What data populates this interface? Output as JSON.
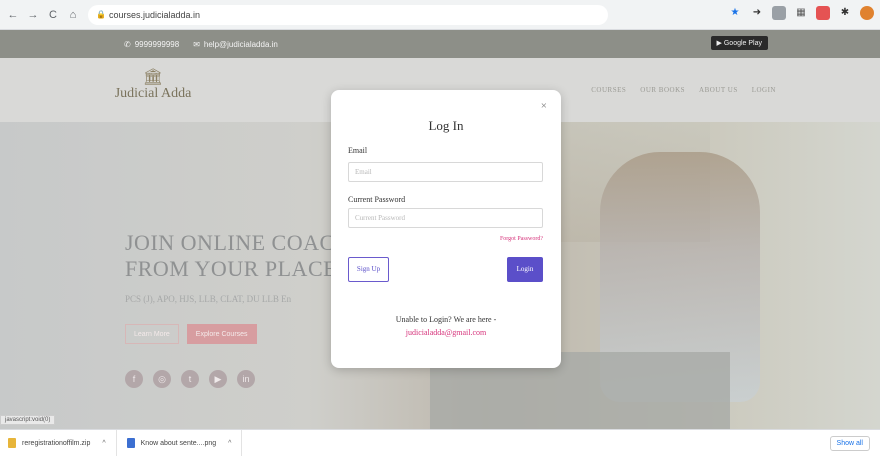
{
  "browser": {
    "url": "courses.judicialadda.in",
    "nav_back": "←",
    "nav_forward": "→",
    "nav_reload": "C",
    "nav_home": "⌂"
  },
  "topbar": {
    "phone": "9999999998",
    "email": "help@judicialadda.in",
    "gplay": "▶ Google Play"
  },
  "header": {
    "logo_mark": "🏛",
    "logo_text": "Judicial Adda",
    "nav": [
      "COURSES",
      "OUR BOOKS",
      "ABOUT US",
      "LOGIN"
    ]
  },
  "hero": {
    "title": "JOIN ONLINE COAC\nFROM YOUR PLACE",
    "subtitle": "PCS (J), APO, HJS, LLB, CLAT, DU LLB En",
    "btn_learn": "Learn More",
    "btn_explore": "Explore Courses",
    "social_icons": [
      "f",
      "◎",
      "t",
      "▶",
      "in"
    ]
  },
  "status_tip": "javascript:void(0)",
  "modal": {
    "close": "×",
    "title": "Log In",
    "email_label": "Email",
    "email_placeholder": "Email",
    "password_label": "Current Password",
    "password_placeholder": "Current Password",
    "forgot": "Forgot Password?",
    "signup": "Sign Up",
    "login": "Login",
    "unable": "Unable to Login? We are here -",
    "support_email": "judicialadda@gmail.com"
  },
  "downloads": {
    "items": [
      {
        "name": "reregistrationoffilm.zip",
        "color": "#e7b53a"
      },
      {
        "name": "Know about sente....png",
        "color": "#3c6fd1"
      }
    ],
    "caret": "^",
    "show_all": "Show all"
  },
  "colors": {
    "accent": "#5b4fc9",
    "link_pink": "#d6337b"
  }
}
